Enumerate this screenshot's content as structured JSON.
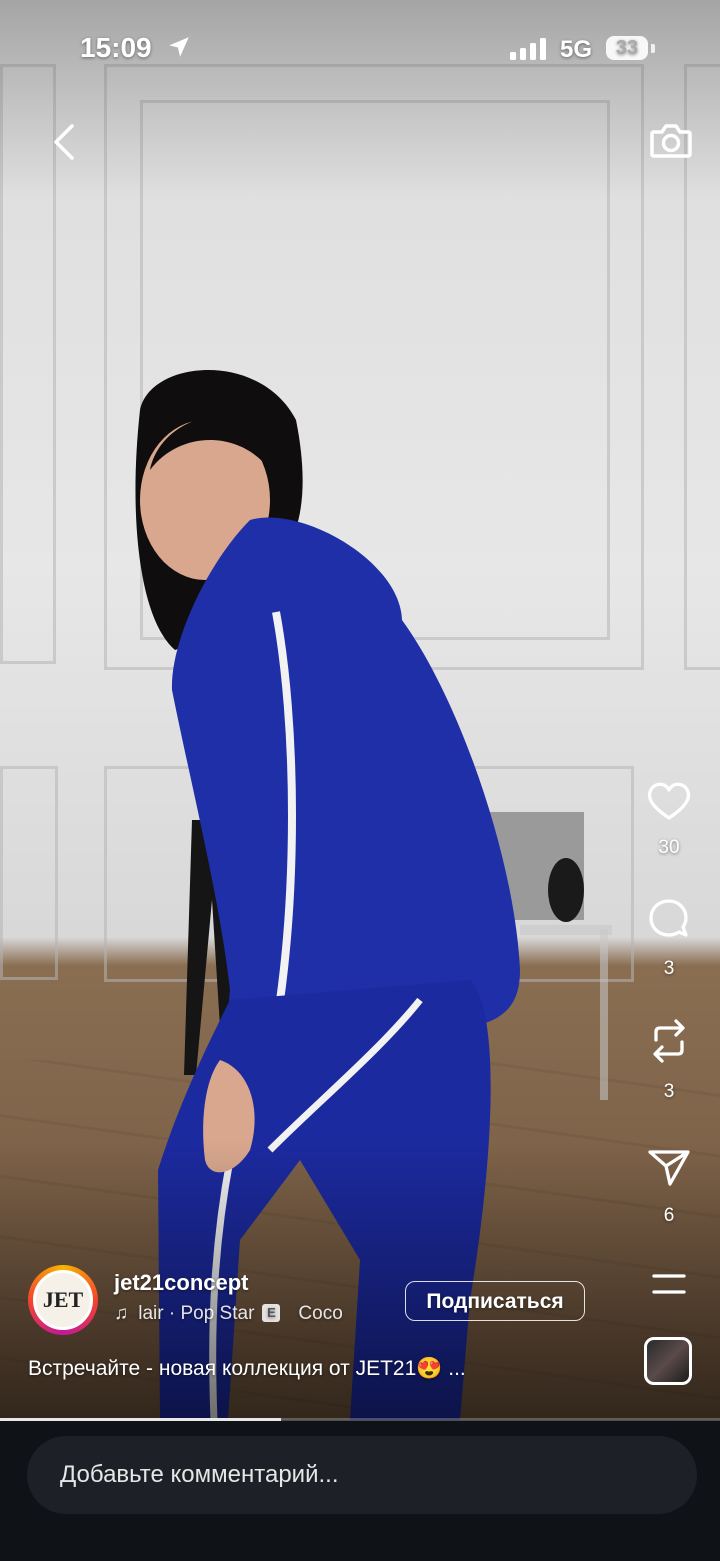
{
  "status_bar": {
    "time": "15:09",
    "network": "5G",
    "battery": "33"
  },
  "actions": {
    "likes": "30",
    "comments": "3",
    "reposts": "3",
    "shares": "6"
  },
  "post": {
    "username": "jet21concept",
    "avatar_text": "JET",
    "music_artist": "lair · Pop Star",
    "explicit_badge": "E",
    "music_track": "Coco",
    "follow_label": "Подписаться",
    "caption": "Встречайте - новая коллекция от JET21😍 ...",
    "progress": 0.39
  },
  "comment_box": {
    "placeholder": "Добавьте комментарий..."
  },
  "colors": {
    "accent_blue": "#1f2fa8",
    "bottom_bar": "#0f1217",
    "comment_field": "#1d2127"
  },
  "icons": [
    "location-arrow-icon",
    "signal-icon",
    "back-chevron-icon",
    "camera-icon",
    "heart-icon",
    "comment-icon",
    "repost-icon",
    "send-icon",
    "menu-icon",
    "music-note-icon"
  ]
}
